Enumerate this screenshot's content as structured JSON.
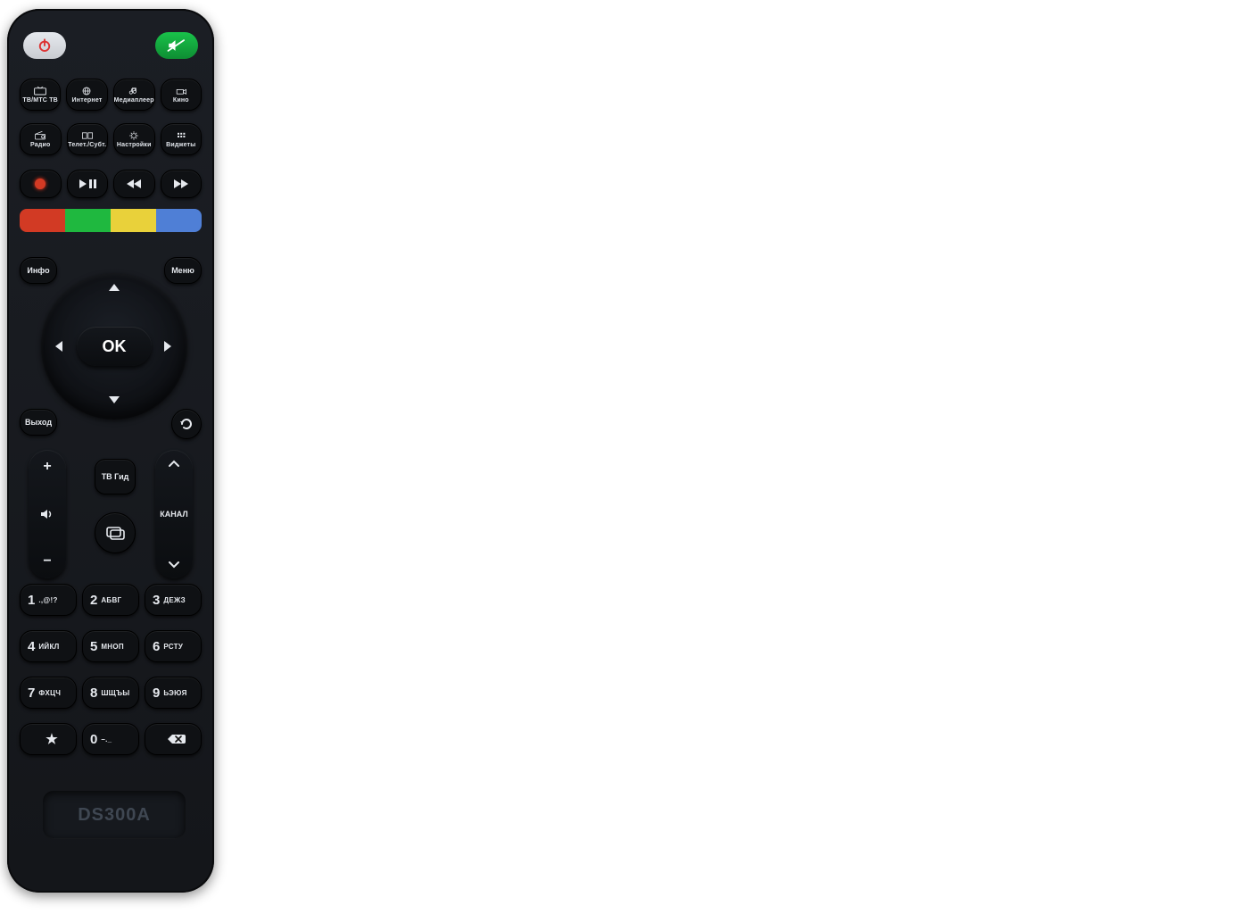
{
  "model": "DS300A",
  "ok_label": "OK",
  "corner_buttons": {
    "info": "Инфо",
    "menu": "Меню",
    "exit": "Выход"
  },
  "center_buttons": {
    "tv_guide": "ТВ Гид"
  },
  "channel_label": "КАНАЛ",
  "source_row_1": [
    {
      "name": "tv-mtstv",
      "label": "ТВ/МТС ТВ"
    },
    {
      "name": "internet",
      "label": "Интернет"
    },
    {
      "name": "mediaplayer",
      "label": "Медиаплеер"
    },
    {
      "name": "cinema",
      "label": "Кино"
    }
  ],
  "source_row_2": [
    {
      "name": "radio",
      "label": "Радио"
    },
    {
      "name": "teletext-subt",
      "label": "Телет./Субт."
    },
    {
      "name": "settings",
      "label": "Настройки"
    },
    {
      "name": "widgets",
      "label": "Виджеты"
    }
  ],
  "keypad": [
    [
      {
        "d": "1",
        "t": ".,@!?"
      },
      {
        "d": "2",
        "t": "АБВГ"
      },
      {
        "d": "3",
        "t": "ДЕЖЗ"
      }
    ],
    [
      {
        "d": "4",
        "t": "ИЙКЛ"
      },
      {
        "d": "5",
        "t": "МНОП"
      },
      {
        "d": "6",
        "t": "РСТУ"
      }
    ],
    [
      {
        "d": "7",
        "t": "ФХЦЧ"
      },
      {
        "d": "8",
        "t": "ШЩЪЫ"
      },
      {
        "d": "9",
        "t": "ЬЭЮЯ"
      }
    ],
    [
      {
        "d": "★",
        "t": ""
      },
      {
        "d": "0",
        "t": "–._"
      },
      {
        "d": "⌫",
        "t": ""
      }
    ]
  ]
}
